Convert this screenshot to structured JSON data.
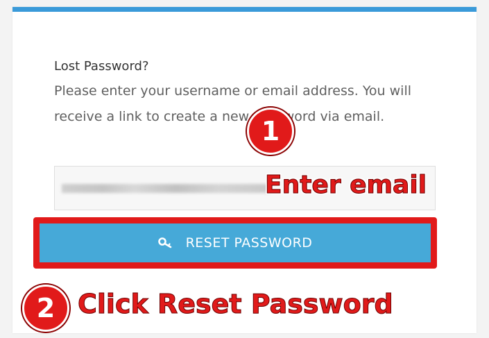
{
  "form": {
    "heading": "Lost Password?",
    "instructions": "Please enter your username or email address. You will receive a link to create a new password via email.",
    "email_value": "",
    "reset_button_label": "RESET PASSWORD",
    "reset_icon": "key-icon"
  },
  "annotations": {
    "step1_number": "1",
    "step1_text": "Enter email",
    "step2_number": "2",
    "step2_text": "Click Reset Password"
  },
  "colors": {
    "accent_bar": "#3a9ad9",
    "button": "#46a9d8",
    "annotation_red": "#e11a1a"
  }
}
